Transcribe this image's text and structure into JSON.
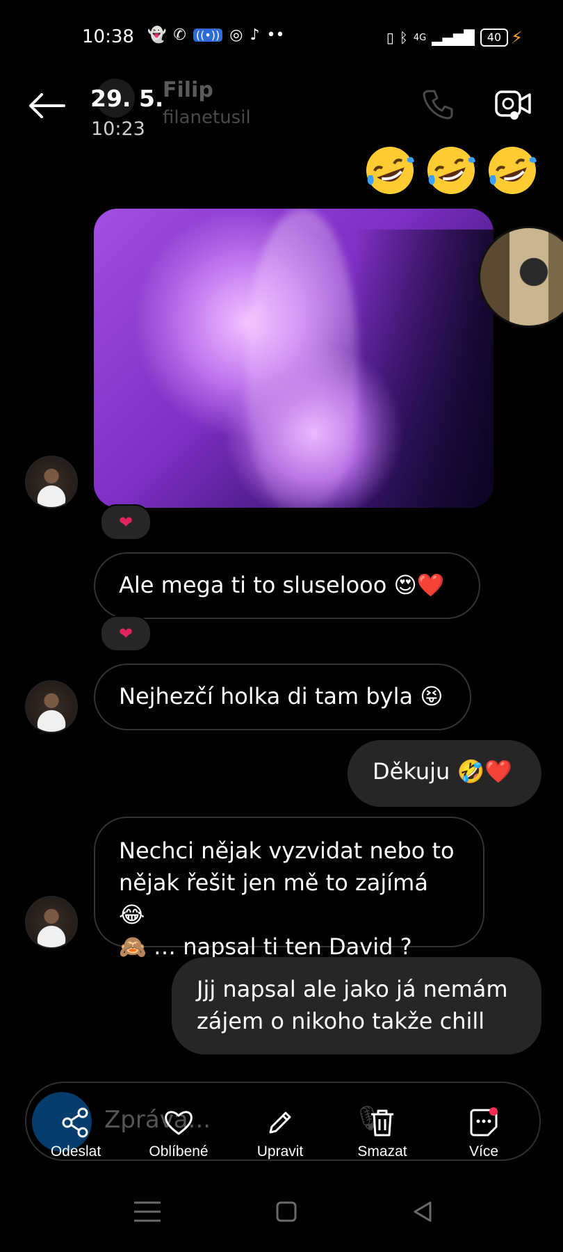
{
  "status_bar": {
    "time": "10:38",
    "network": "4G",
    "battery": "40"
  },
  "header": {
    "date": "29. 5.",
    "time": "10:23",
    "name": "Filip",
    "username": "filanetusil"
  },
  "reactions": {
    "heart": "❤"
  },
  "messages": [
    {
      "direction": "incoming",
      "text": "Ale mega ti to sluselooo 😍❤️"
    },
    {
      "direction": "incoming",
      "text": "Nejhezčí holka di tam byla 😝"
    },
    {
      "direction": "outgoing",
      "text": "Děkuju 🤣❤️"
    },
    {
      "direction": "incoming",
      "lines": [
        "Nechci nějak vyzvidat nebo to",
        "nějak řešit jen mě to zajímá 😂",
        "🙈 … napsal ti ten David ?"
      ]
    },
    {
      "direction": "outgoing",
      "lines": [
        "Jjj napsal ale jako já nemám",
        "zájem o nikoho takže chill"
      ]
    }
  ],
  "composer": {
    "placeholder": "Zpráva..."
  },
  "actions": [
    {
      "label": "Odeslat",
      "icon": "share-icon"
    },
    {
      "label": "Oblíbené",
      "icon": "heart-icon"
    },
    {
      "label": "Upravit",
      "icon": "pencil-icon"
    },
    {
      "label": "Smazat",
      "icon": "trash-icon"
    },
    {
      "label": "Více",
      "icon": "more-sticker-icon"
    }
  ],
  "colors": {
    "background": "#000000",
    "outgoing_bubble": "#262626",
    "heart": "#e0245e"
  }
}
